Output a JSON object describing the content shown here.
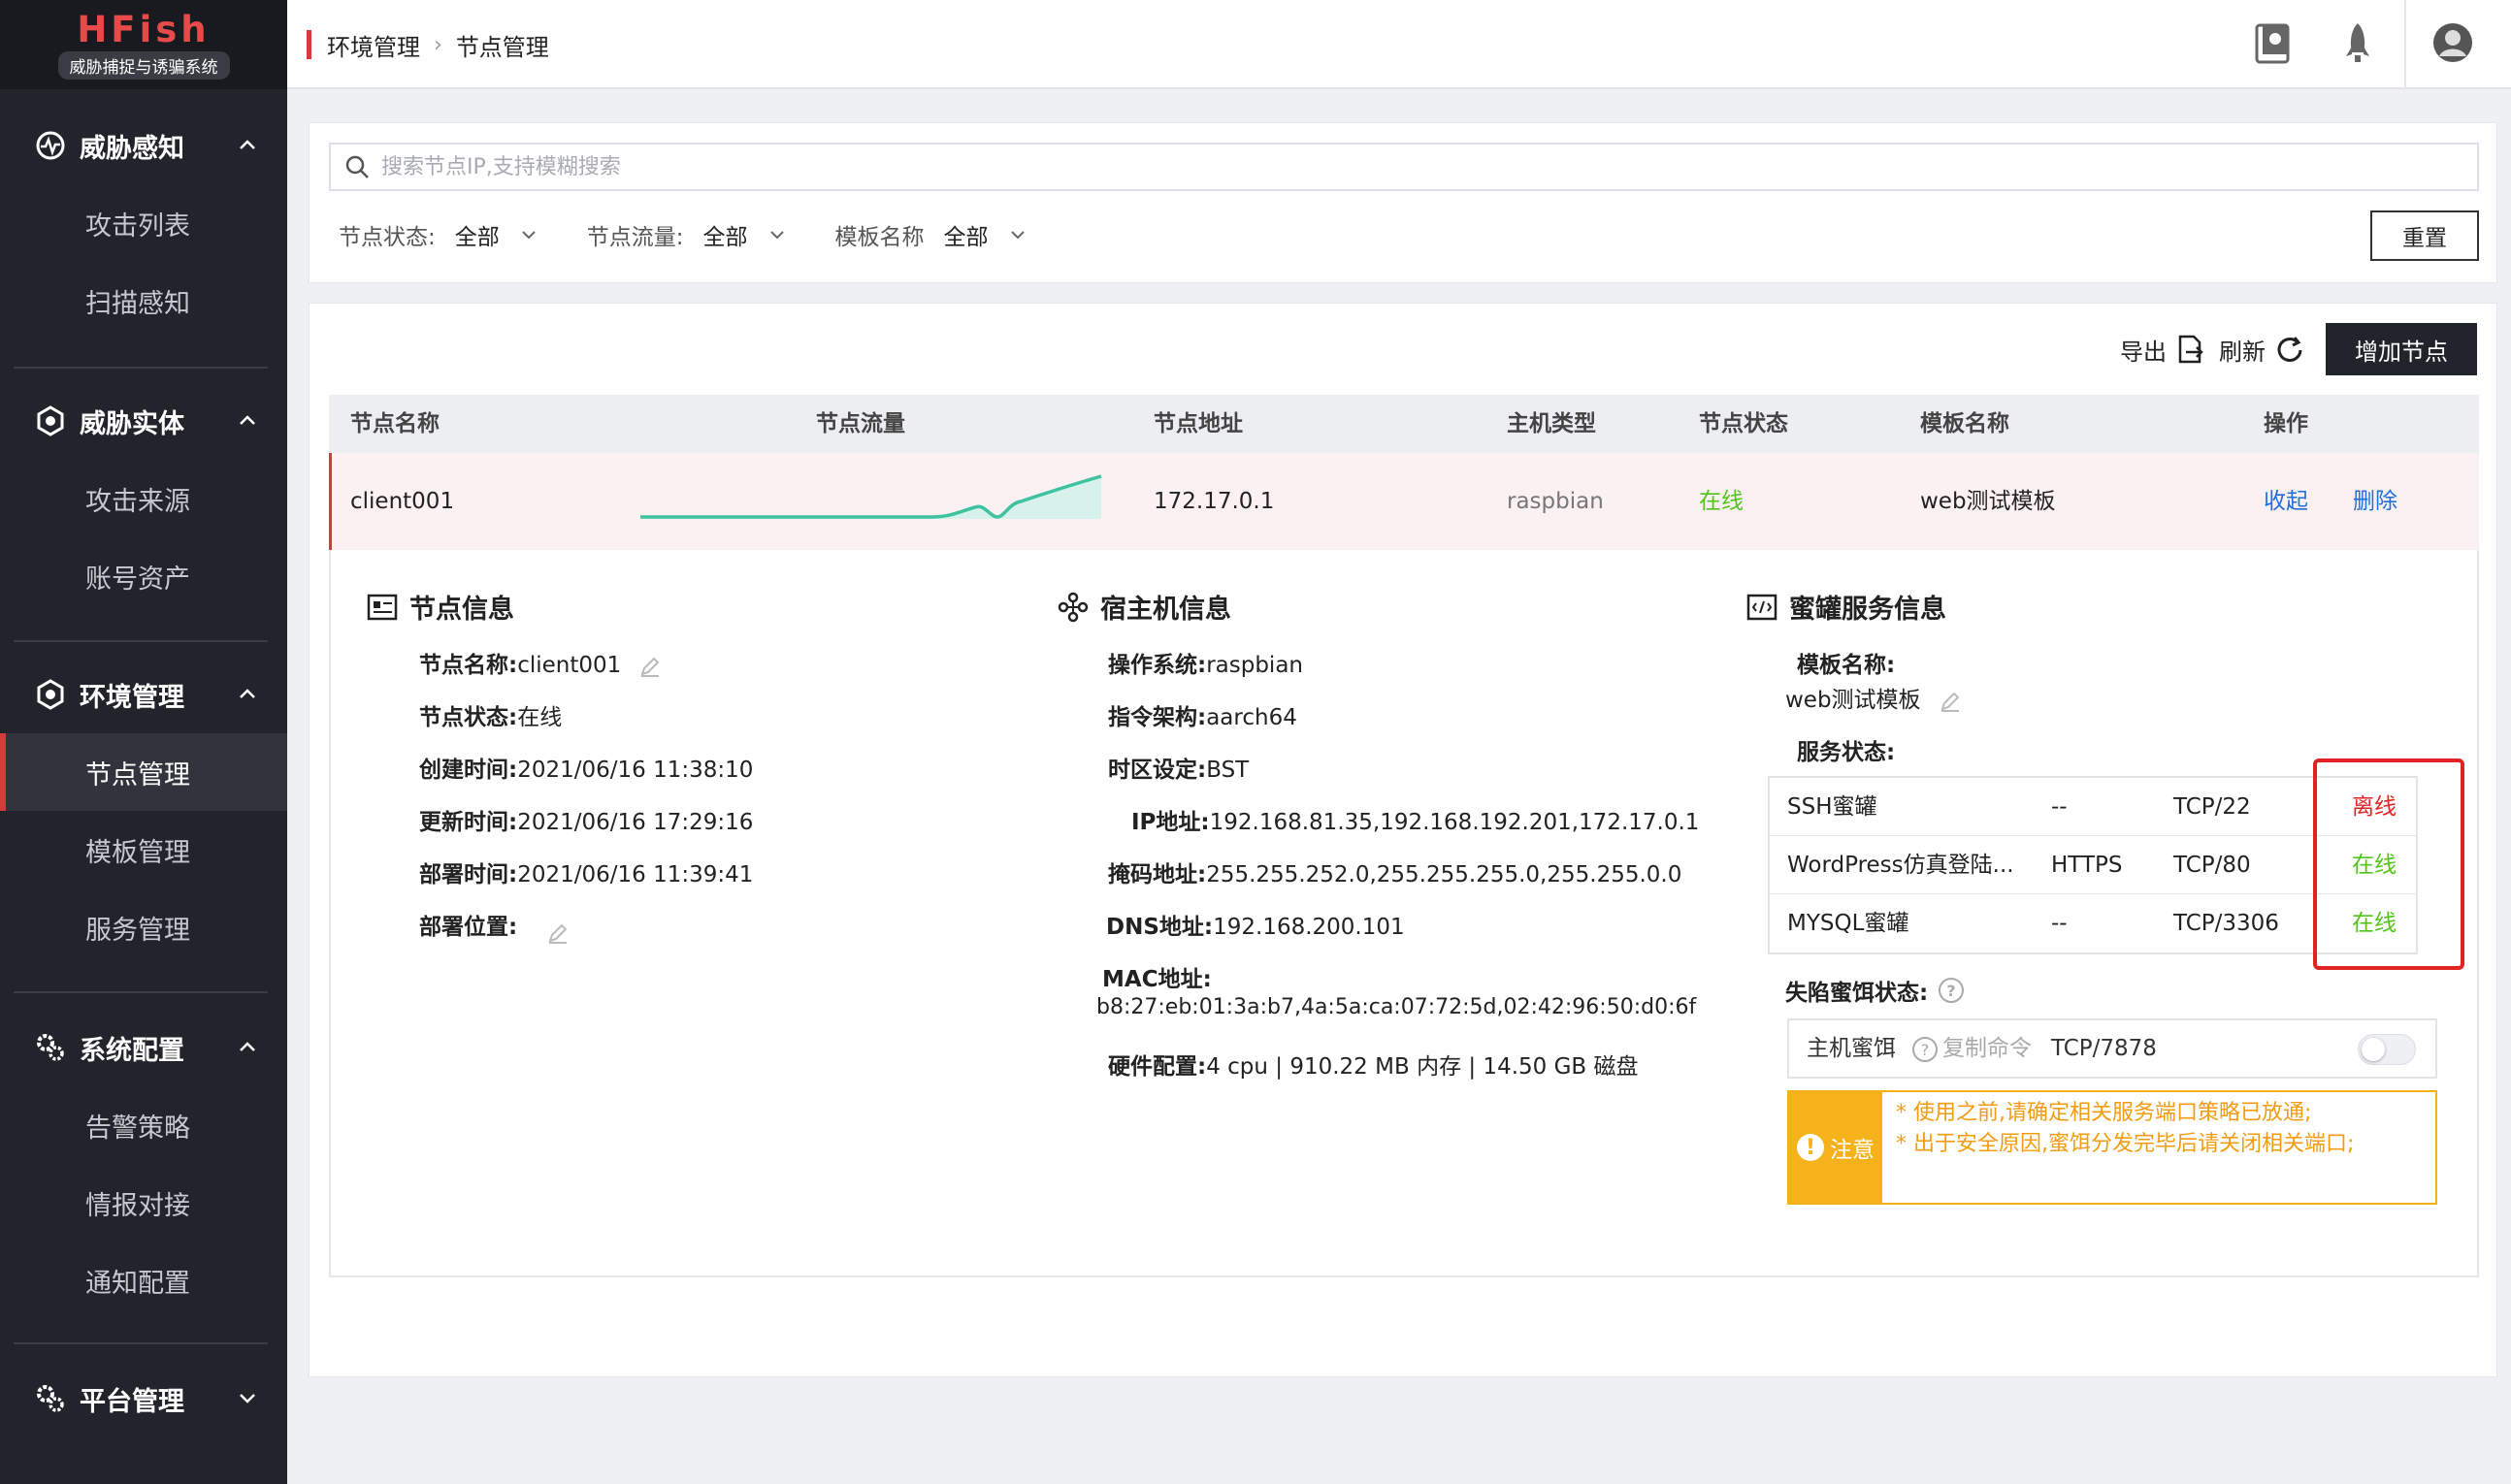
{
  "app": {
    "title": "HFish",
    "subtitle": "威胁捕捉与诱骗系统"
  },
  "nav": {
    "groups": [
      {
        "label": "威胁感知",
        "items": [
          "攻击列表",
          "扫描感知"
        ]
      },
      {
        "label": "威胁实体",
        "items": [
          "攻击来源",
          "账号资产"
        ]
      },
      {
        "label": "环境管理",
        "items": [
          "节点管理",
          "模板管理",
          "服务管理"
        ]
      },
      {
        "label": "系统配置",
        "items": [
          "告警策略",
          "情报对接",
          "通知配置"
        ]
      },
      {
        "label": "平台管理",
        "items": []
      }
    ]
  },
  "breadcrumb": {
    "parent": "环境管理",
    "current": "节点管理"
  },
  "search": {
    "placeholder": "搜索节点IP,支持模糊搜索"
  },
  "filters": [
    {
      "label": "节点状态:",
      "value": "全部"
    },
    {
      "label": "节点流量:",
      "value": "全部"
    },
    {
      "label": "模板名称",
      "value": "全部"
    }
  ],
  "reset_label": "重置",
  "actions": {
    "export": "导出",
    "refresh": "刷新",
    "add_node": "增加节点"
  },
  "table": {
    "headers": [
      "节点名称",
      "节点流量",
      "节点地址",
      "主机类型",
      "节点状态",
      "模板名称",
      "操作"
    ],
    "row": {
      "name": "client001",
      "address": "172.17.0.1",
      "host_type": "raspbian",
      "status": "在线",
      "template": "web测试模板",
      "op_collapse": "收起",
      "op_delete": "删除"
    }
  },
  "node_info": {
    "title": "节点信息",
    "fields": [
      {
        "k": "节点名称:",
        "v": "client001"
      },
      {
        "k": "节点状态:",
        "v": "在线"
      },
      {
        "k": "创建时间:",
        "v": "2021/06/16 11:38:10"
      },
      {
        "k": "更新时间:",
        "v": "2021/06/16 17:29:16"
      },
      {
        "k": "部署时间:",
        "v": "2021/06/16 11:39:41"
      },
      {
        "k": "部署位置:",
        "v": ""
      }
    ]
  },
  "host_info": {
    "title": "宿主机信息",
    "fields": [
      {
        "k": "操作系统:",
        "v": "raspbian"
      },
      {
        "k": "指令架构:",
        "v": "aarch64"
      },
      {
        "k": "时区设定:",
        "v": "BST"
      },
      {
        "k": "IP地址:",
        "v": "192.168.81.35,192.168.192.201,172.17.0.1"
      },
      {
        "k": "掩码地址:",
        "v": "255.255.252.0,255.255.255.0,255.255.0.0"
      },
      {
        "k": "DNS地址:",
        "v": "192.168.200.101"
      },
      {
        "k": "MAC地址:",
        "v": "b8:27:eb:01:3a:b7,4a:5a:ca:07:72:5d,02:42:96:50:d0:6f"
      },
      {
        "k": "硬件配置:",
        "v": "4 cpu | 910.22 MB 内存 | 14.50 GB 磁盘"
      }
    ]
  },
  "honeypot_info": {
    "title": "蜜罐服务信息",
    "template_label": "模板名称:",
    "template_value": "web测试模板",
    "service_status_label": "服务状态:",
    "services": [
      {
        "name": "SSH蜜罐",
        "proto": "--",
        "port": "TCP/22",
        "status": "离线",
        "color": "#e02424"
      },
      {
        "name": "WordPress仿真登陆...",
        "proto": "HTTPS",
        "port": "TCP/80",
        "status": "在线",
        "color": "#52c41a"
      },
      {
        "name": "MYSQL蜜罐",
        "proto": "--",
        "port": "TCP/3306",
        "status": "在线",
        "color": "#52c41a"
      }
    ],
    "bait_label": "失陷蜜饵状态:",
    "bait": {
      "name": "主机蜜饵",
      "copy": "复制命令",
      "port": "TCP/7878"
    },
    "notice": {
      "label": "注意",
      "lines": [
        "* 使用之前,请确定相关服务端口策略已放通;",
        "* 出于安全原因,蜜饵分发完毕后请关闭相关端口;"
      ]
    }
  },
  "colors": {
    "accent": "#d83a3a",
    "online": "#52c41a",
    "offline": "#e02424",
    "link": "#1e6fd9",
    "warn": "#f6b21b",
    "traffic": "#3fc2a0"
  }
}
